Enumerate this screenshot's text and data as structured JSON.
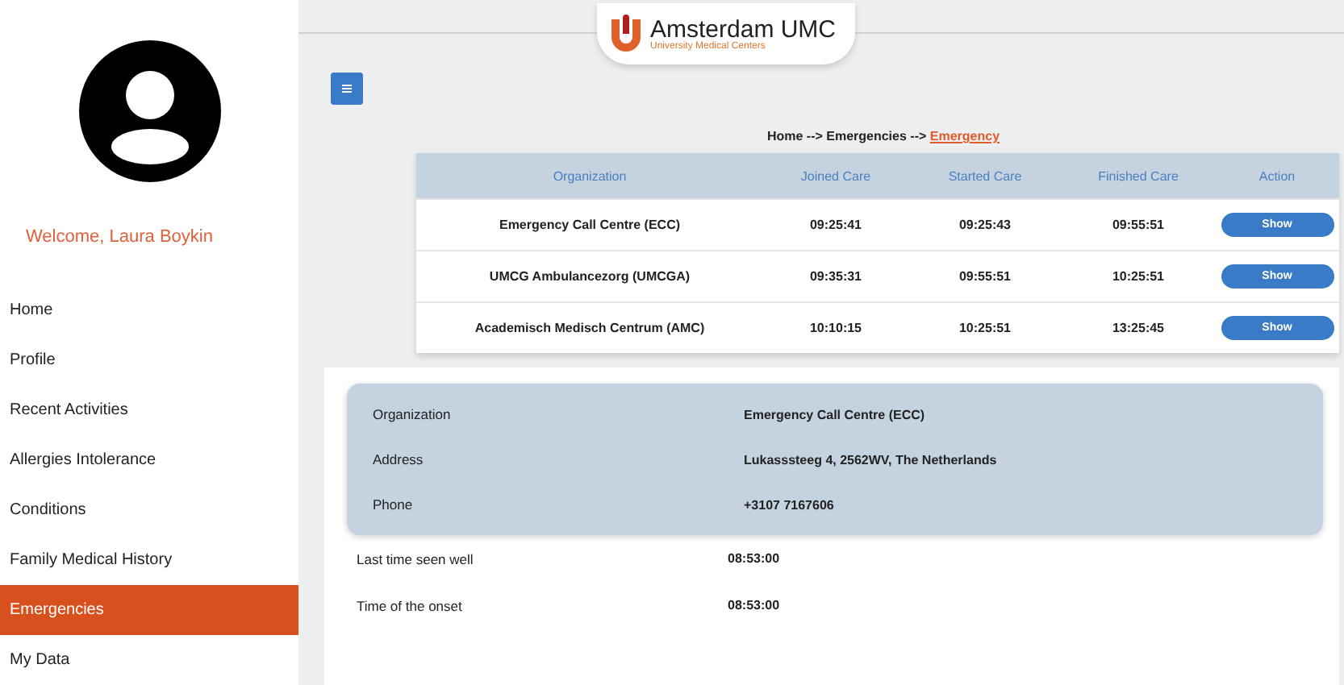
{
  "logo": {
    "name": "Amsterdam UMC",
    "tagline": "University Medical Centers"
  },
  "sidebar": {
    "welcome": "Welcome, Laura Boykin",
    "items": [
      {
        "label": "Home",
        "selected": false
      },
      {
        "label": "Profile",
        "selected": false
      },
      {
        "label": "Recent Activities",
        "selected": false
      },
      {
        "label": "Allergies Intolerance",
        "selected": false
      },
      {
        "label": "Conditions",
        "selected": false
      },
      {
        "label": "Family Medical History",
        "selected": false
      },
      {
        "label": "Emergencies",
        "selected": true
      },
      {
        "label": "My Data",
        "selected": false
      }
    ]
  },
  "breadcrumb": {
    "path": "Home --> Emergencies -->",
    "current": "Emergency"
  },
  "table": {
    "columns": [
      "Organization",
      "Joined Care",
      "Started Care",
      "Finished Care",
      "Action"
    ],
    "rows": [
      {
        "organization": "Emergency Call Centre (ECC)",
        "joined": "09:25:41",
        "started": "09:25:43",
        "finished": "09:55:51",
        "action": "Show"
      },
      {
        "organization": "UMCG Ambulancezorg (UMCGA)",
        "joined": "09:35:31",
        "started": "09:55:51",
        "finished": "10:25:51",
        "action": "Show"
      },
      {
        "organization": "Academisch Medisch Centrum (AMC)",
        "joined": "10:10:15",
        "started": "10:25:51",
        "finished": "13:25:45",
        "action": "Show"
      }
    ]
  },
  "details": {
    "contact": [
      {
        "label": "Organization",
        "value": "Emergency Call Centre (ECC)"
      },
      {
        "label": "Address",
        "value": "Lukasssteeg 4, 2562WV, The Netherlands"
      },
      {
        "label": "Phone",
        "value": "+3107 7167606"
      }
    ],
    "times": [
      {
        "label": "Last time seen well",
        "value": "08:53:00"
      },
      {
        "label": "Time of the onset",
        "value": "08:53:00"
      }
    ]
  }
}
